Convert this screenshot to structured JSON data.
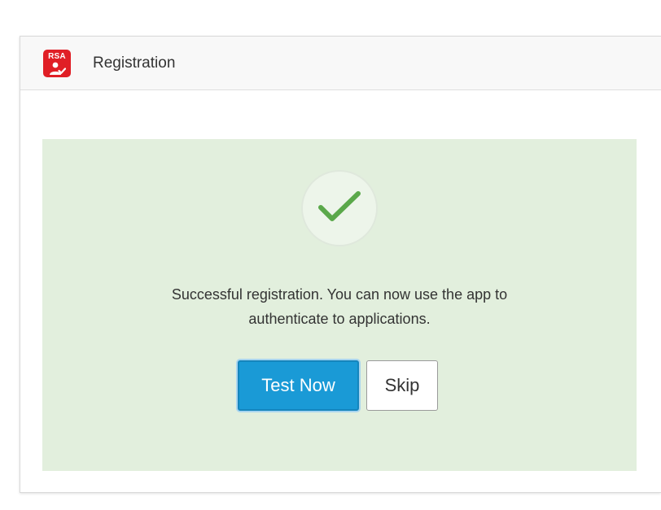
{
  "header": {
    "logo_text": "RSA",
    "title": "Registration",
    "brand_color": "#e01f26"
  },
  "result": {
    "status_icon": "checkmark-icon",
    "message_line1": "Successful registration. You can now use the app to",
    "message_line2": "authenticate to applications.",
    "panel_color": "#e2efdd",
    "check_color": "#5aa84a"
  },
  "actions": {
    "test_now_label": "Test Now",
    "skip_label": "Skip",
    "primary_color": "#1a9ad6"
  }
}
